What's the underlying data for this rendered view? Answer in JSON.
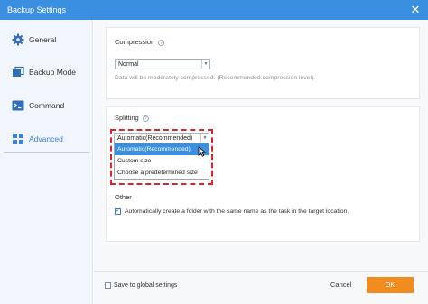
{
  "window": {
    "title": "Backup Settings",
    "close_glyph": "✕"
  },
  "sidebar": {
    "items": [
      {
        "label": "General",
        "icon": "gear-icon"
      },
      {
        "label": "Backup Mode",
        "icon": "backup-mode-icon"
      },
      {
        "label": "Command",
        "icon": "command-icon"
      },
      {
        "label": "Advanced",
        "icon": "grid-icon",
        "active": true
      }
    ]
  },
  "compression": {
    "label": "Compression",
    "selected": "Normal",
    "description": "Data will be moderately compressed. (Recommended compression level)."
  },
  "splitting": {
    "label": "Splitting",
    "selected": "Automatic(Recommended)",
    "options": [
      "Automatic(Recommended)",
      "Custom size",
      "Choose a predetermined size"
    ]
  },
  "other": {
    "label": "Other",
    "checkbox_label": "Automatically create a folder with the same name as the task in the target location.",
    "checked": true
  },
  "footer": {
    "save_global_label": "Save to global settings",
    "cancel_label": "Cancel",
    "ok_label": "OK"
  },
  "colors": {
    "accent": "#3b8fe0",
    "ok_button": "#f28c1f",
    "highlight": "#d9262c"
  }
}
